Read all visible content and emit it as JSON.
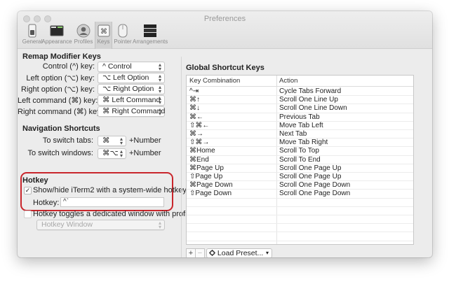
{
  "window": {
    "title": "Preferences"
  },
  "toolbar": [
    {
      "label": "General",
      "icon": "switch-icon"
    },
    {
      "label": "Appearance",
      "icon": "window-icon"
    },
    {
      "label": "Profiles",
      "icon": "person-icon"
    },
    {
      "label": "Keys",
      "icon": "command-key-icon",
      "selected": true
    },
    {
      "label": "Pointer",
      "icon": "mouse-icon"
    },
    {
      "label": "Arrangements",
      "icon": "windows-stack-icon"
    }
  ],
  "remap": {
    "title": "Remap Modifier Keys",
    "rows": [
      {
        "label": "Control (^) key:",
        "value": "^ Control"
      },
      {
        "label": "Left option (⌥) key:",
        "value": "⌥ Left Option"
      },
      {
        "label": "Right option (⌥) key:",
        "value": "⌥ Right Option"
      },
      {
        "label": "Left command (⌘) key:",
        "value": "⌘ Left Command"
      },
      {
        "label": "Right command (⌘) key:",
        "value": "⌘ Right Command"
      }
    ]
  },
  "navigation": {
    "title": "Navigation Shortcuts",
    "rows": [
      {
        "label": "To switch tabs:",
        "value": "⌘",
        "suffix": "+Number"
      },
      {
        "label": "To switch windows:",
        "value": "⌘⌥",
        "suffix": "+Number"
      }
    ]
  },
  "hotkey": {
    "title": "Hotkey",
    "show_hide_label": "Show/hide iTerm2 with a system-wide hotkey",
    "show_hide_checked": "✓",
    "hotkey_label": "Hotkey:",
    "hotkey_value": "^`",
    "dedicated_label": "Hotkey toggles a dedicated window with profile:",
    "profile_value": "Hotkey Window"
  },
  "global": {
    "title": "Global Shortcut Keys",
    "columns": [
      "Key Combination",
      "Action"
    ],
    "rows": [
      {
        "key": "^⇥",
        "action": "Cycle Tabs Forward"
      },
      {
        "key": "⌘↑",
        "action": "Scroll One Line Up"
      },
      {
        "key": "⌘↓",
        "action": "Scroll One Line Down"
      },
      {
        "key": "⌘←",
        "action": "Previous Tab"
      },
      {
        "key": "⇧⌘←",
        "action": "Move Tab Left"
      },
      {
        "key": "⌘→",
        "action": "Next Tab"
      },
      {
        "key": "⇧⌘→",
        "action": "Move Tab Right"
      },
      {
        "key": "⌘Home",
        "action": "Scroll To Top"
      },
      {
        "key": "⌘End",
        "action": "Scroll To End"
      },
      {
        "key": "⌘Page Up",
        "action": "Scroll One Page Up"
      },
      {
        "key": "⇧Page Up",
        "action": "Scroll One Page Up"
      },
      {
        "key": "⌘Page Down",
        "action": "Scroll One Page Down"
      },
      {
        "key": "⇧Page Down",
        "action": "Scroll One Page Down"
      }
    ],
    "add_label": "+",
    "remove_label": "−",
    "preset_label": "Load Preset...",
    "preset_icon": "gear-icon"
  }
}
